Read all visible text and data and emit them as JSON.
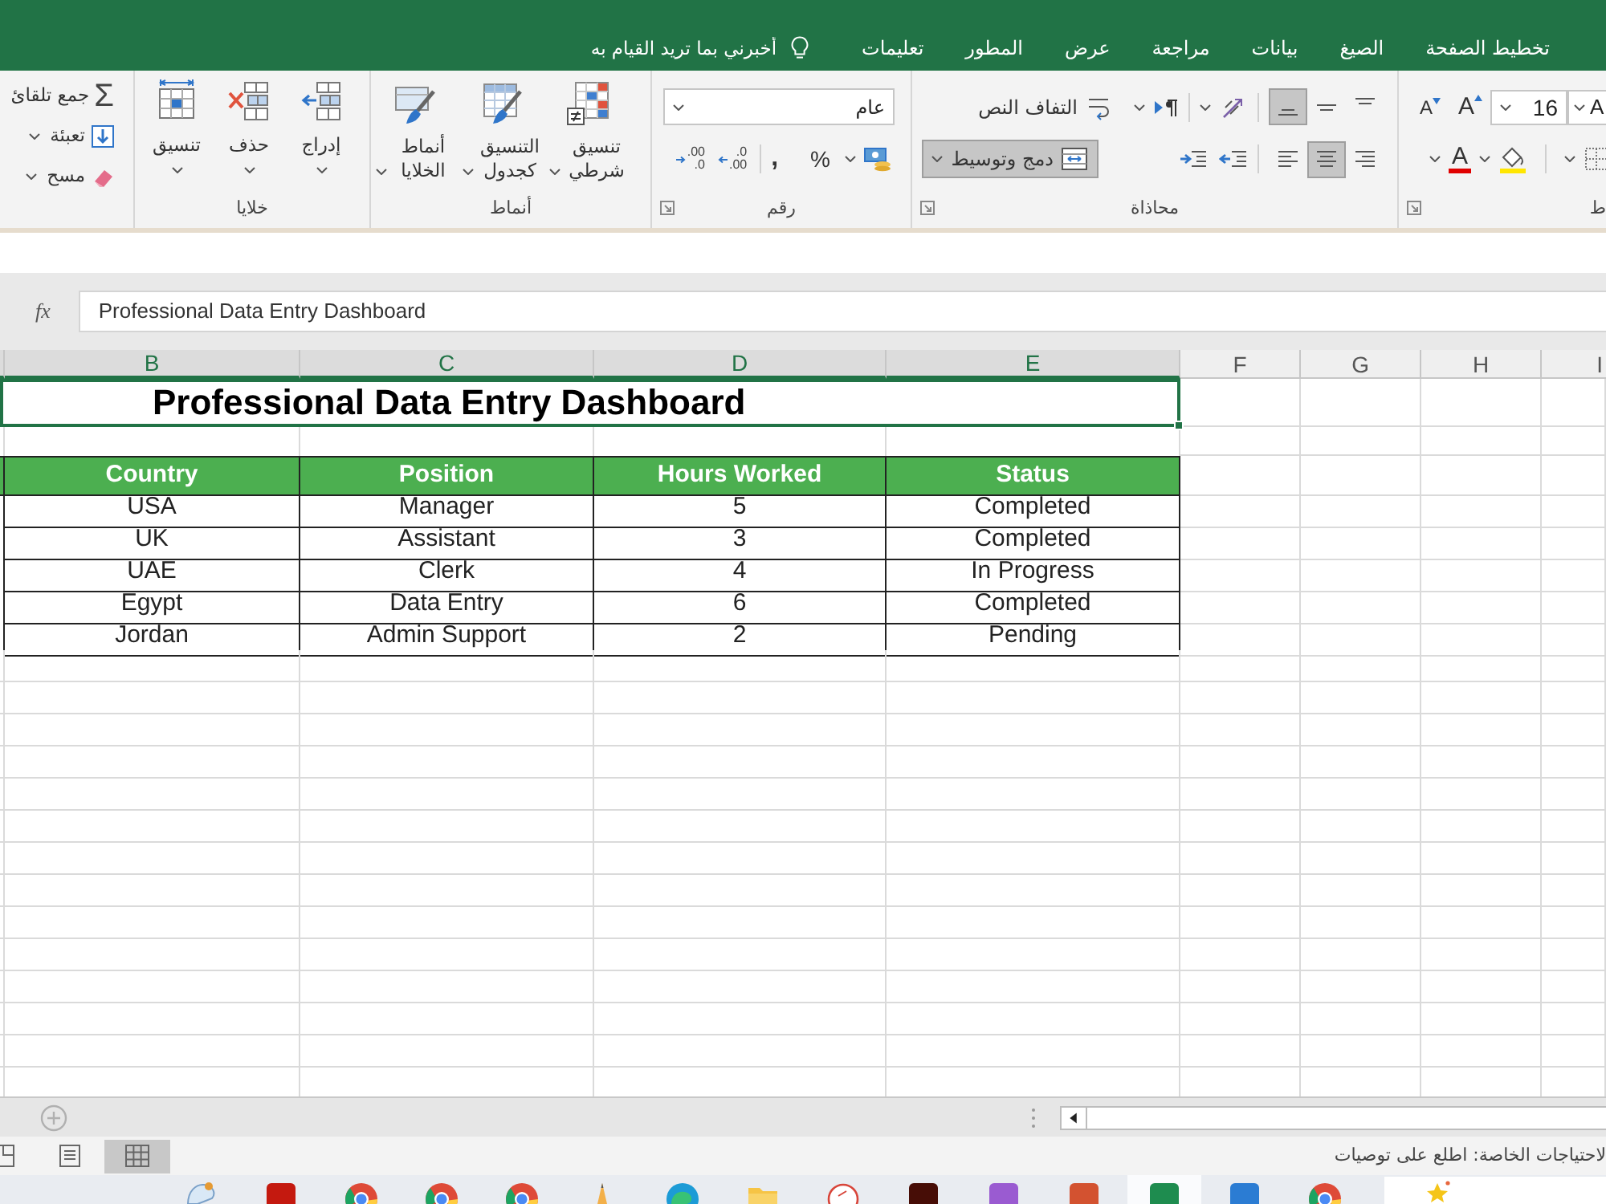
{
  "menu": {
    "tabs": [
      {
        "label": "تخطيط الصفحة",
        "selected": false
      },
      {
        "label": "الصيغ",
        "selected": false
      },
      {
        "label": "بيانات",
        "selected": false
      },
      {
        "label": "مراجعة",
        "selected": false
      },
      {
        "label": "عرض",
        "selected": false
      },
      {
        "label": "المطور",
        "selected": false
      },
      {
        "label": "تعليمات",
        "selected": false
      }
    ],
    "tell_me": {
      "placeholder": "أخبرني بما تريد القيام به"
    }
  },
  "ribbon": {
    "groups": [
      {
        "kind": "font",
        "label": "ط",
        "font_name": "A",
        "font_size": "16",
        "grow_font": "A",
        "shrink_font": "A",
        "font_color": "A"
      },
      {
        "kind": "alignment",
        "label": "محاذاة",
        "vertical": [
          {
            "kind": "top",
            "selected": false
          },
          {
            "kind": "middle",
            "selected": false
          },
          {
            "kind": "bottom",
            "selected": true
          }
        ],
        "horizontal": [
          {
            "kind": "right",
            "selected": false
          },
          {
            "kind": "center",
            "selected": true
          },
          {
            "kind": "left",
            "selected": false
          }
        ],
        "wrap_text": "التفاف النص",
        "merge": {
          "label": "دمج وتوسيط",
          "selected": true
        }
      },
      {
        "kind": "number",
        "label": "رقم",
        "format": "عام",
        "percent": "%",
        "comma": ",",
        "decimals": [
          {
            "kind": "increase",
            "upper": ".0",
            "lower": ".00"
          },
          {
            "kind": "decrease",
            "upper": ".00",
            "lower": ".0"
          }
        ]
      },
      {
        "kind": "styles",
        "label": "أنماط",
        "buttons": [
          {
            "kind": "conditional",
            "label": "تنسيق شرطي"
          },
          {
            "kind": "table",
            "label": "التنسيق كجدول"
          },
          {
            "kind": "cell",
            "label": "أنماط الخلايا"
          }
        ]
      },
      {
        "kind": "cells",
        "label": "خلايا",
        "buttons": [
          {
            "kind": "insert",
            "label": "إدراج"
          },
          {
            "kind": "delete",
            "label": "حذف"
          },
          {
            "kind": "format",
            "label": "تنسيق"
          }
        ]
      },
      {
        "kind": "editing",
        "buttons": [
          {
            "kind": "sum",
            "symbol": "Σ",
            "label": "جمع تلقائ"
          },
          {
            "kind": "fill",
            "label": "تعبئة"
          },
          {
            "kind": "clear",
            "label": "مسح"
          }
        ]
      }
    ]
  },
  "formula_bar": {
    "function_label": "fx",
    "value": "Professional Data Entry Dashboard"
  },
  "sheet": {
    "columns": [
      {
        "label": "I",
        "selected": false
      },
      {
        "label": "H",
        "selected": false
      },
      {
        "label": "G",
        "selected": false
      },
      {
        "label": "F",
        "selected": false
      },
      {
        "label": "E",
        "selected": true
      },
      {
        "label": "D",
        "selected": true
      },
      {
        "label": "C",
        "selected": true
      },
      {
        "label": "B",
        "selected": true
      }
    ],
    "title": "Professional Data Entry Dashboard",
    "table": {
      "columns": [
        "Status",
        "Hours Worked",
        "Position",
        "Country"
      ],
      "rows": [
        [
          "Completed",
          "5",
          "Manager",
          "USA"
        ],
        [
          "Completed",
          "3",
          "Assistant",
          "UK"
        ],
        [
          "In Progress",
          "4",
          "Clerk",
          "UAE"
        ],
        [
          "Completed",
          "6",
          "Data Entry",
          "Egypt"
        ],
        [
          "Pending",
          "2",
          "Admin Support",
          "Jordan"
        ]
      ]
    }
  },
  "status_bar": {
    "views": [
      {
        "kind": "page_break",
        "selected": false
      },
      {
        "kind": "page_layout",
        "selected": false
      },
      {
        "kind": "normal",
        "selected": true
      }
    ],
    "text": "لاحتياجات الخاصة: اطلع على توصيات"
  },
  "taskbar": {
    "items": [
      {
        "kind": "palette",
        "selected": false
      },
      {
        "kind": "tile",
        "color": "#c4190f",
        "selected": false
      },
      {
        "kind": "ring",
        "selected": false
      },
      {
        "kind": "ring",
        "selected": false
      },
      {
        "kind": "ring",
        "selected": false
      },
      {
        "kind": "pencil",
        "selected": false
      },
      {
        "kind": "swirl",
        "selected": false
      },
      {
        "kind": "folder",
        "selected": false
      },
      {
        "kind": "circle",
        "selected": false
      },
      {
        "kind": "tile",
        "color": "#470d06",
        "selected": false
      },
      {
        "kind": "tile",
        "color": "#9a5bd1",
        "selected": false
      },
      {
        "kind": "tile",
        "color": "#d35230",
        "selected": false
      },
      {
        "kind": "tile",
        "color": "#1e8c4f",
        "selected": true
      },
      {
        "kind": "tile",
        "color": "#2b7cd3",
        "selected": false
      },
      {
        "kind": "ring",
        "selected": false
      }
    ]
  }
}
